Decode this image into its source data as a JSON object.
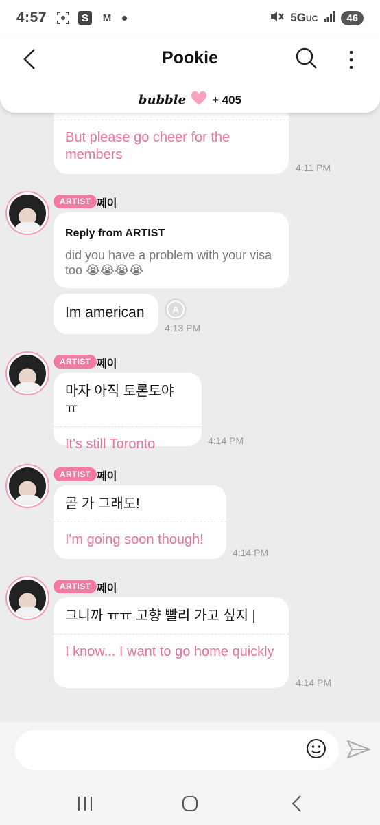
{
  "status": {
    "time": "4:57",
    "icon_s": "S",
    "icon_m": "M",
    "network": "5G",
    "network_sub": "UC",
    "battery": "46"
  },
  "header": {
    "title": "Pookie",
    "brand": "bubble",
    "count": "+ 405"
  },
  "messages": [
    {
      "partial": true,
      "en": "But please go cheer for the members",
      "time": "4:11 PM"
    },
    {
      "badge": "ARTIST",
      "sender": "쩨이",
      "reply_head": "Reply from ARTIST",
      "reply_body": "did you have a problem with your visa too 😭😭😭😭"
    },
    {
      "user": true,
      "text": "Im american",
      "read_icon": "A",
      "time": "4:13 PM"
    },
    {
      "badge": "ARTIST",
      "sender": "쩨이",
      "ko": "마자 아직 토론토야 ㅠ",
      "en": "It's still Toronto",
      "time": "4:14 PM"
    },
    {
      "badge": "ARTIST",
      "sender": "쩨이",
      "ko": "곧 가 그래도!",
      "en": "I'm going soon though!",
      "time": "4:14 PM"
    },
    {
      "badge": "ARTIST",
      "sender": "쩨이",
      "ko": "그니까 ㅠㅠ 고향 빨리 가고 싶지 |",
      "en": "I know... I want to go home quickly",
      "time": "4:14 PM"
    }
  ],
  "colors": {
    "accent": "#f37aa2",
    "translation": "#e8729a",
    "background": "#ececee"
  }
}
